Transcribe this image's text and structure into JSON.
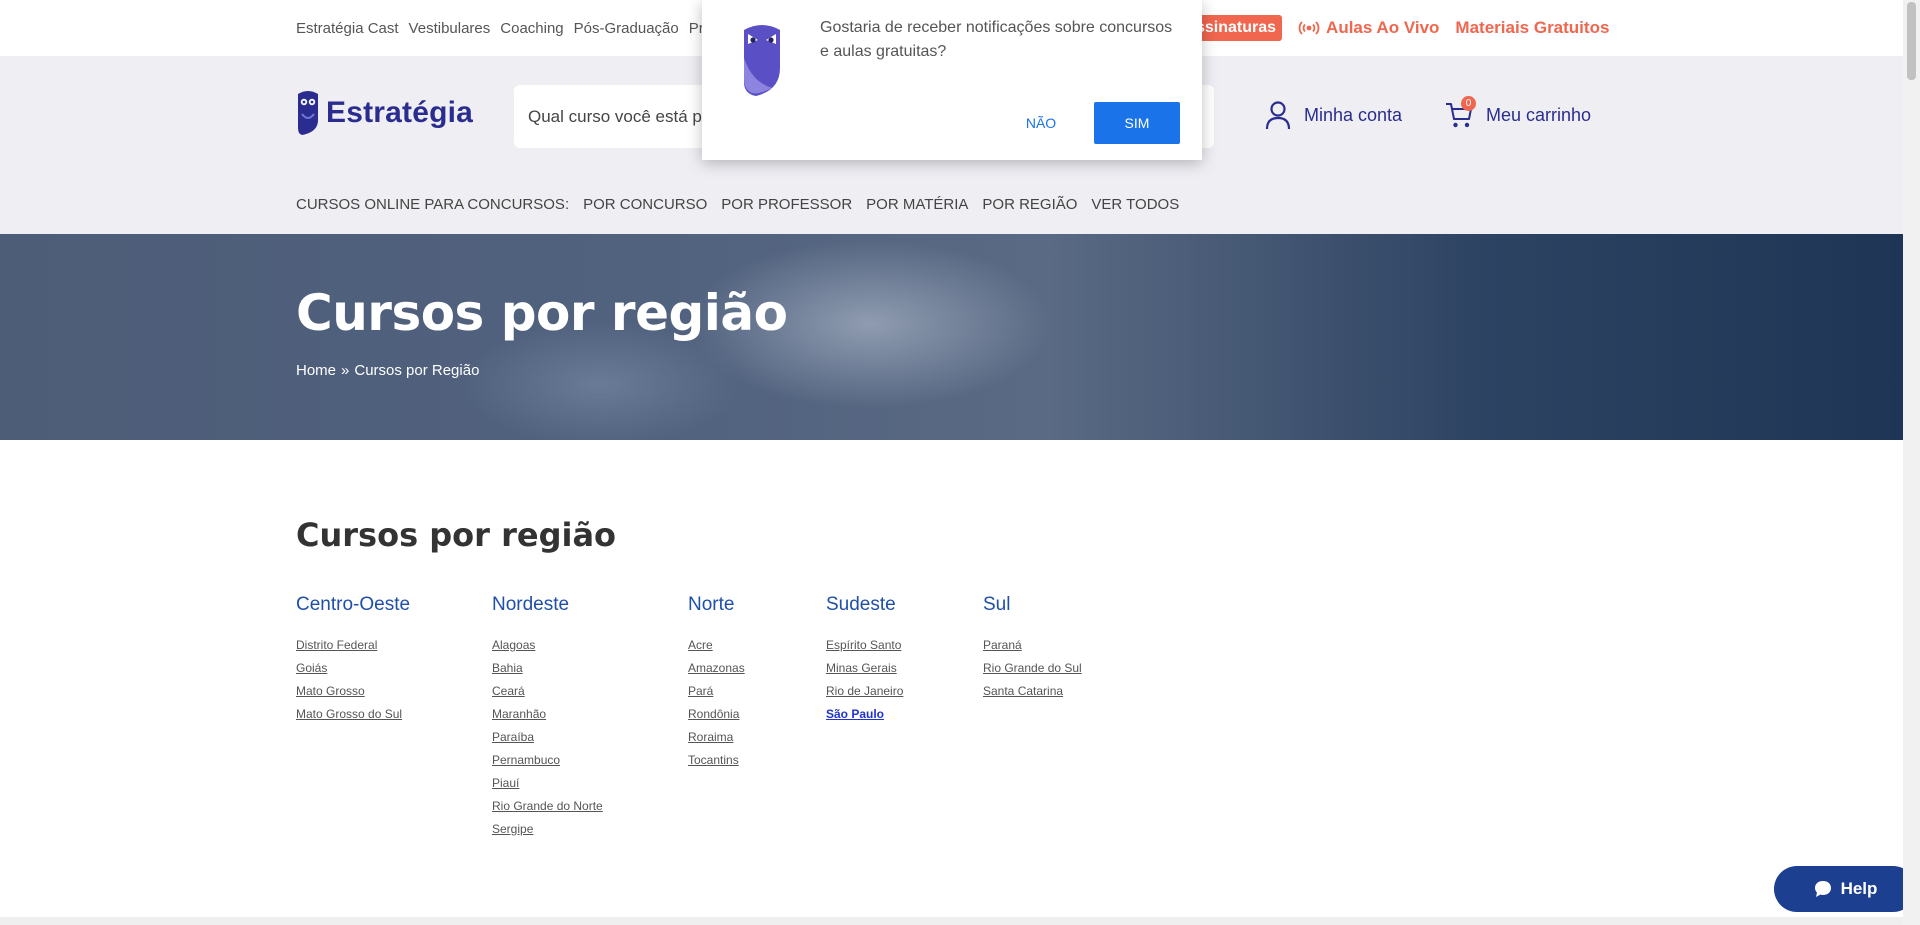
{
  "topbar": {
    "links": [
      "Estratégia Cast",
      "Vestibulares",
      "Coaching",
      "Pós-Graduação",
      "Profe"
    ],
    "assinaturas_label": "ssinaturas",
    "live_label": "Aulas Ao Vivo",
    "free_label": "Materiais Gratuitos"
  },
  "header": {
    "logo_text": "Estratégia",
    "search_placeholder": "Qual curso você está pr",
    "account_label": "Minha conta",
    "cart_label": "Meu carrinho",
    "cart_count": "0"
  },
  "catnav": {
    "label": "CURSOS ONLINE PARA CONCURSOS:",
    "items": [
      "POR CONCURSO",
      "POR PROFESSOR",
      "POR MATÉRIA",
      "POR REGIÃO",
      "VER TODOS"
    ]
  },
  "hero": {
    "title": "Cursos por região",
    "breadcrumb_home": "Home",
    "breadcrumb_sep": "»",
    "breadcrumb_current": "Cursos por Região"
  },
  "content": {
    "title": "Cursos por região",
    "regions": [
      {
        "name": "Centro-Oeste",
        "states": [
          "Distrito Federal",
          "Goiás",
          "Mato Grosso",
          "Mato Grosso do Sul"
        ]
      },
      {
        "name": "Nordeste",
        "states": [
          "Alagoas",
          "Bahia",
          "Ceará",
          "Maranhão",
          "Paraíba",
          "Pernambuco",
          "Piauí",
          "Rio Grande do Norte",
          "Sergipe"
        ]
      },
      {
        "name": "Norte",
        "states": [
          "Acre",
          "Amazonas",
          "Pará",
          "Rondônia",
          "Roraima",
          "Tocantins"
        ]
      },
      {
        "name": "Sudeste",
        "states": [
          "Espírito Santo",
          "Minas Gerais",
          "Rio de Janeiro",
          "São Paulo"
        ]
      },
      {
        "name": "Sul",
        "states": [
          "Paraná",
          "Rio Grande do Sul",
          "Santa Catarina"
        ]
      }
    ]
  },
  "popup": {
    "message": "Gostaria de receber notificações sobre concursos e aulas gratuitas?",
    "no_label": "NÃO",
    "yes_label": "SIM"
  },
  "help": {
    "label": "Help"
  },
  "colors": {
    "accent": "#f0664e",
    "brand": "#2a2d8f",
    "link": "#1f4fa8",
    "button": "#1a73e8"
  }
}
